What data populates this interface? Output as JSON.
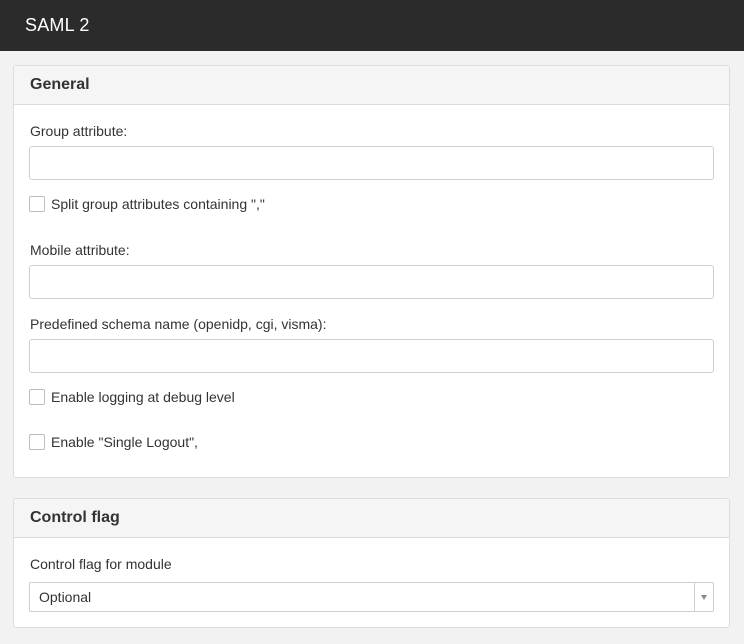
{
  "header": {
    "title": "SAML 2"
  },
  "general": {
    "heading": "General",
    "group_attribute_label": "Group attribute:",
    "group_attribute_value": "",
    "split_group_label": "Split group attributes containing \",\"",
    "mobile_attribute_label": "Mobile attribute:",
    "mobile_attribute_value": "",
    "schema_name_label": "Predefined schema name (openidp, cgi, visma):",
    "schema_name_value": "",
    "debug_logging_label": "Enable logging at debug level",
    "single_logout_label": "Enable \"Single Logout\","
  },
  "control_flag": {
    "heading": "Control flag",
    "label": "Control flag for module",
    "selected": "Optional"
  }
}
